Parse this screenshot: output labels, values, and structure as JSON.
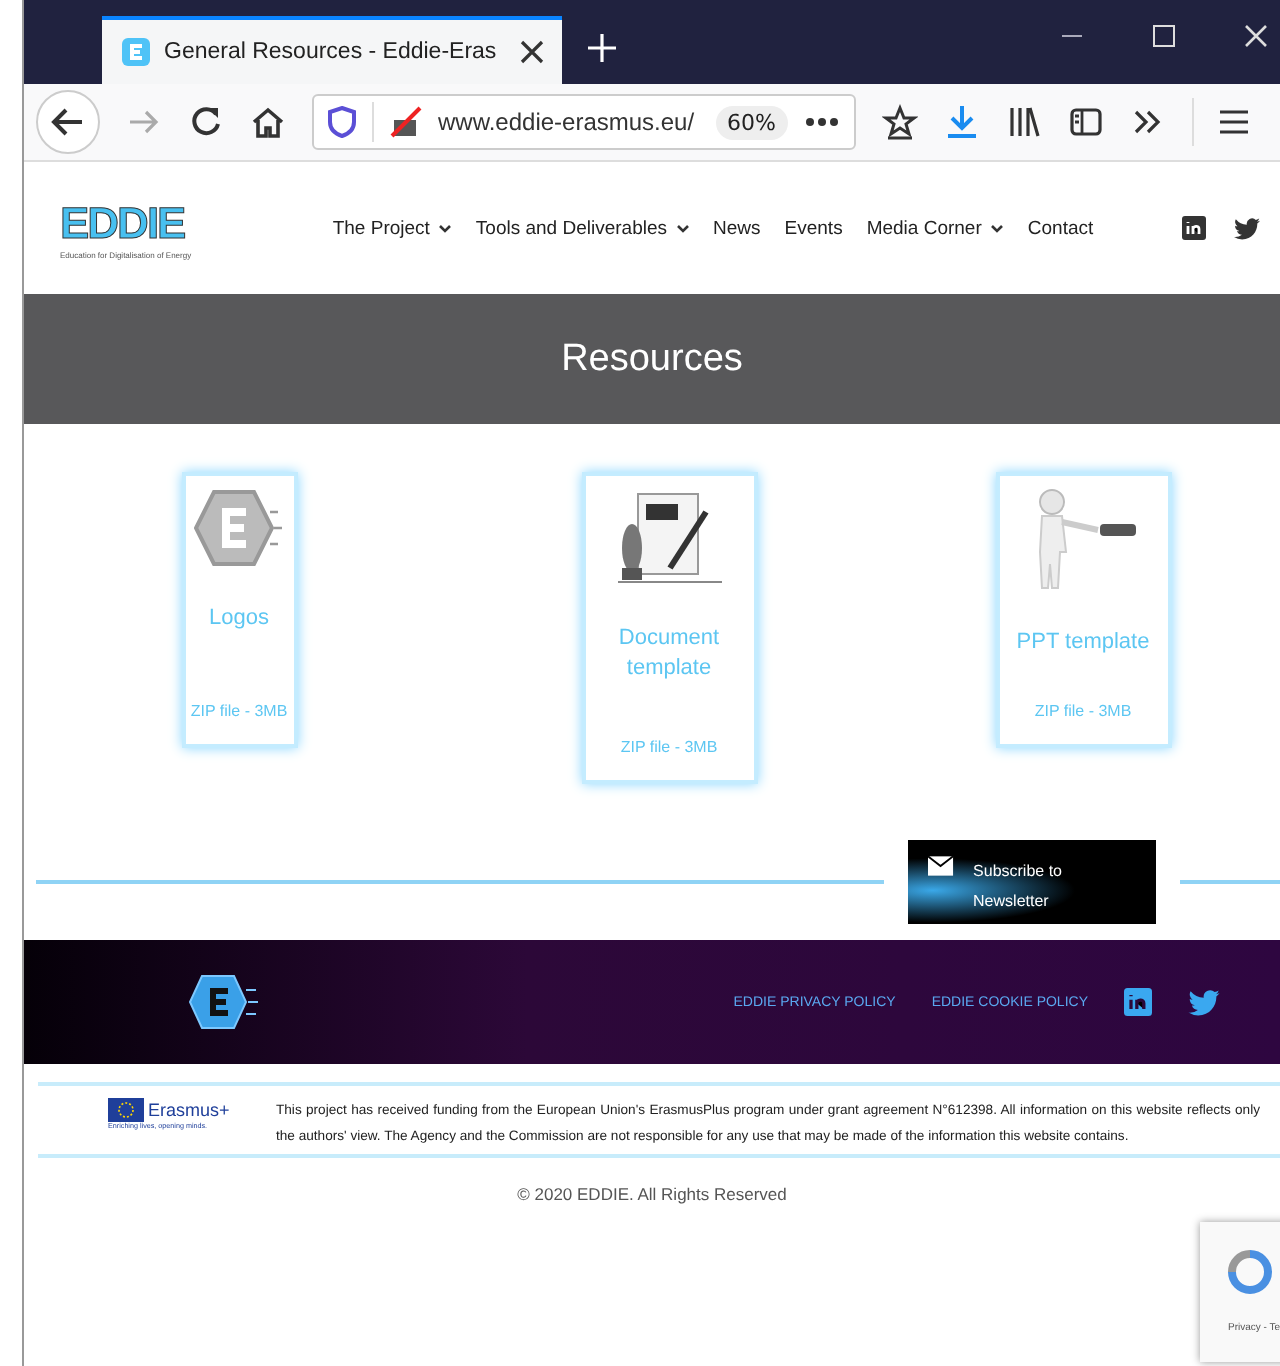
{
  "browser": {
    "tab_title": "General Resources - Eddie-Eras",
    "url": "www.eddie-erasmus.eu/",
    "zoom": "60%"
  },
  "header": {
    "logo_text": "EDDIE",
    "logo_tagline": "Education for Digitalisation of Energy",
    "nav": [
      {
        "label": "The Project",
        "has_caret": true
      },
      {
        "label": "Tools and Deliverables",
        "has_caret": true
      },
      {
        "label": "News",
        "has_caret": false
      },
      {
        "label": "Events",
        "has_caret": false
      },
      {
        "label": "Media Corner",
        "has_caret": true
      },
      {
        "label": "Contact",
        "has_caret": false
      }
    ]
  },
  "hero": {
    "title": "Resources"
  },
  "resources": [
    {
      "kind": "logo",
      "title": "Logos",
      "file": "ZIP file - 3MB"
    },
    {
      "kind": "document",
      "title": "Document template",
      "file": "ZIP file - 3MB"
    },
    {
      "kind": "figure",
      "title": "PPT template",
      "file": "ZIP file - 3MB"
    }
  ],
  "newsletter": {
    "label": "Subscribe to Newsletter"
  },
  "footer": {
    "links": [
      "EDDIE PRIVACY POLICY",
      "EDDIE COOKIE POLICY"
    ]
  },
  "funding": {
    "logo_text": "Erasmus+",
    "logo_slogan": "Enriching lives, opening minds.",
    "text": "This project has received funding from the European Union's ErasmusPlus program under grant agreement N°612398. All information on this website reflects only the authors' view. The Agency and the Commission are not responsible for any use that may be made of the information this website contains."
  },
  "copyright": "© 2020 EDDIE. All Rights Reserved",
  "recaptcha": {
    "text": "Privacy - Te"
  }
}
